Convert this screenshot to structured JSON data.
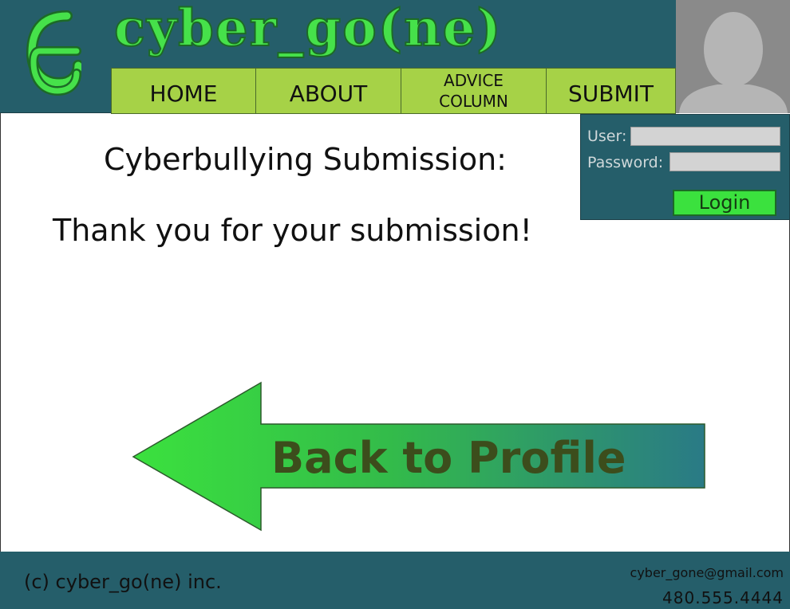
{
  "brand": {
    "name": "cyber_go(ne)"
  },
  "nav": {
    "items": [
      {
        "label": "HOME"
      },
      {
        "label": "ABOUT"
      },
      {
        "label": "ADVICE\nCOLUMN"
      },
      {
        "label": "SUBMIT"
      }
    ]
  },
  "login": {
    "user_label": "User:",
    "password_label": "Password:",
    "user_value": "",
    "password_value": "",
    "button_label": "Login"
  },
  "main": {
    "heading": "Cyberbullying Submission:",
    "message": "Thank you for your submission!",
    "back_label": "Back to Profile"
  },
  "footer": {
    "copyright": "(c) cyber_go(ne) inc.",
    "email": "cyber_gone@gmail.com",
    "phone": "480.555.4444"
  },
  "colors": {
    "header_bg": "#255e6a",
    "brand_green": "#46e14a",
    "nav_green": "#a6d247",
    "arrow_start": "#3be13e",
    "arrow_end": "#2a7a86"
  },
  "icons": {
    "logo": "cg-logo-icon",
    "avatar": "user-silhouette-icon",
    "back": "left-arrow-icon"
  }
}
